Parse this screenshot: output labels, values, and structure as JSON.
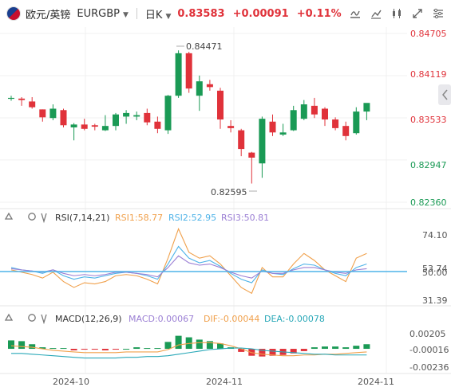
{
  "header": {
    "symbol_name": "欧元/英镑",
    "symbol_code": "EURGBP",
    "period": "日K",
    "last_price": "0.83583",
    "change": "+0.00091",
    "change_pct": "+0.11%",
    "tool_icons": [
      "indicator-icon",
      "compare-icon",
      "draw-icon",
      "fullscreen-icon",
      "settings-icon"
    ]
  },
  "main_chart": {
    "y_ticks": [
      "0.84705",
      "0.84119",
      "0.83533",
      "0.82947",
      "0.82360"
    ],
    "high_label": "0.84471",
    "low_label": "0.82595",
    "colors": {
      "up": "#1a9a55",
      "down": "#e0323a"
    }
  },
  "rsi": {
    "title": "RSI(7,14,21)",
    "rsi1": "RSI1:58.77",
    "rsi2": "RSI2:52.95",
    "rsi3": "RSI3:50.81",
    "y_ticks": [
      "74.10",
      "53.74",
      "50.00",
      "31.39"
    ],
    "colors": {
      "rsi1": "#f0a04b",
      "rsi2": "#4fb3e8",
      "rsi3": "#9b7fd4"
    }
  },
  "macd": {
    "title": "MACD(12,26,9)",
    "macd": "MACD:0.00067",
    "dif": "DIF:-0.00044",
    "dea": "DEA:-0.00078",
    "y_ticks": [
      "0.00205",
      "-0.00016",
      "-0.00236"
    ],
    "colors": {
      "macd": "#9b7fd4",
      "dif": "#f0a04b",
      "dea": "#29a8b8"
    }
  },
  "x_axis": {
    "labels": [
      "2024-10",
      "2024-11",
      "2024-11"
    ]
  },
  "chart_data": {
    "type": "candlestick",
    "title": "",
    "ylim": [
      0.8236,
      0.84705
    ],
    "candles": [
      {
        "o": 0.838,
        "h": 0.8384,
        "l": 0.8377,
        "c": 0.8381
      },
      {
        "o": 0.838,
        "h": 0.8382,
        "l": 0.837,
        "c": 0.8378
      },
      {
        "o": 0.8376,
        "h": 0.8382,
        "l": 0.8366,
        "c": 0.8368
      },
      {
        "o": 0.8365,
        "h": 0.8365,
        "l": 0.8348,
        "c": 0.8354
      },
      {
        "o": 0.8353,
        "h": 0.8372,
        "l": 0.835,
        "c": 0.8366
      },
      {
        "o": 0.8364,
        "h": 0.8366,
        "l": 0.834,
        "c": 0.8343
      },
      {
        "o": 0.834,
        "h": 0.8346,
        "l": 0.8322,
        "c": 0.8344
      },
      {
        "o": 0.8344,
        "h": 0.8352,
        "l": 0.8336,
        "c": 0.8338
      },
      {
        "o": 0.8343,
        "h": 0.8345,
        "l": 0.8336,
        "c": 0.8341
      },
      {
        "o": 0.8336,
        "h": 0.8357,
        "l": 0.8335,
        "c": 0.8342
      },
      {
        "o": 0.8342,
        "h": 0.836,
        "l": 0.8336,
        "c": 0.8358
      },
      {
        "o": 0.8355,
        "h": 0.8364,
        "l": 0.8345,
        "c": 0.836
      },
      {
        "o": 0.8355,
        "h": 0.8362,
        "l": 0.835,
        "c": 0.8357
      },
      {
        "o": 0.836,
        "h": 0.8366,
        "l": 0.8343,
        "c": 0.8347
      },
      {
        "o": 0.8348,
        "h": 0.8355,
        "l": 0.8332,
        "c": 0.8338
      },
      {
        "o": 0.8336,
        "h": 0.8385,
        "l": 0.8331,
        "c": 0.8384
      },
      {
        "o": 0.8384,
        "h": 0.8447,
        "l": 0.8381,
        "c": 0.8443
      },
      {
        "o": 0.8443,
        "h": 0.8445,
        "l": 0.8388,
        "c": 0.8394
      },
      {
        "o": 0.8384,
        "h": 0.8412,
        "l": 0.8363,
        "c": 0.8404
      },
      {
        "o": 0.84,
        "h": 0.8406,
        "l": 0.8391,
        "c": 0.8396
      },
      {
        "o": 0.8391,
        "h": 0.8395,
        "l": 0.8338,
        "c": 0.8351
      },
      {
        "o": 0.8342,
        "h": 0.835,
        "l": 0.8333,
        "c": 0.8339
      },
      {
        "o": 0.8336,
        "h": 0.8338,
        "l": 0.83,
        "c": 0.831
      },
      {
        "o": 0.8305,
        "h": 0.8306,
        "l": 0.8262,
        "c": 0.8298
      },
      {
        "o": 0.829,
        "h": 0.8355,
        "l": 0.827,
        "c": 0.8352
      },
      {
        "o": 0.8348,
        "h": 0.8358,
        "l": 0.8328,
        "c": 0.8333
      },
      {
        "o": 0.833,
        "h": 0.8345,
        "l": 0.8328,
        "c": 0.8333
      },
      {
        "o": 0.8336,
        "h": 0.837,
        "l": 0.8335,
        "c": 0.8364
      },
      {
        "o": 0.8352,
        "h": 0.8378,
        "l": 0.835,
        "c": 0.8372
      },
      {
        "o": 0.837,
        "h": 0.8381,
        "l": 0.8353,
        "c": 0.8358
      },
      {
        "o": 0.8366,
        "h": 0.8368,
        "l": 0.8342,
        "c": 0.8351
      },
      {
        "o": 0.8351,
        "h": 0.8354,
        "l": 0.8336,
        "c": 0.8339
      },
      {
        "o": 0.8342,
        "h": 0.8348,
        "l": 0.8322,
        "c": 0.8328
      },
      {
        "o": 0.8332,
        "h": 0.8368,
        "l": 0.833,
        "c": 0.8362
      },
      {
        "o": 0.8362,
        "h": 0.8373,
        "l": 0.835,
        "c": 0.8374
      }
    ],
    "rsi": {
      "ylim": [
        20,
        88
      ],
      "rsi1": [
        50,
        48,
        46,
        43,
        48,
        40,
        35,
        39,
        38,
        40,
        45,
        46,
        45,
        42,
        38,
        60,
        85,
        65,
        60,
        62,
        55,
        45,
        35,
        30,
        52,
        44,
        44,
        55,
        64,
        58,
        50,
        45,
        40,
        60,
        64
      ],
      "rsi2": [
        52,
        50,
        49,
        47,
        50,
        45,
        42,
        44,
        43,
        45,
        47,
        48,
        47,
        45,
        42,
        55,
        70,
        60,
        56,
        58,
        53,
        47,
        42,
        39,
        50,
        47,
        46,
        51,
        55,
        54,
        50,
        47,
        45,
        52,
        55
      ],
      "rsi3": [
        51,
        50,
        49,
        48,
        50,
        47,
        45,
        46,
        45,
        46,
        48,
        48,
        47,
        46,
        44,
        52,
        62,
        56,
        54,
        55,
        52,
        48,
        45,
        43,
        49,
        47,
        47,
        50,
        52,
        52,
        50,
        48,
        47,
        50,
        51
      ]
    },
    "macd": {
      "ylim": [
        -0.0029,
        0.0027
      ],
      "hist": [
        0.0011,
        0.001,
        0.0006,
        0.0002,
        0.0001,
        0.0001,
        -0.0002,
        -0.0001,
        -0.0001,
        -0.0002,
        -0.0001,
        0.0,
        0.0002,
        0.0001,
        0.0001,
        0.0009,
        0.0017,
        0.0015,
        0.0012,
        0.001,
        0.0007,
        0.0002,
        -0.0004,
        -0.0009,
        -0.001,
        -0.0009,
        -0.0008,
        -0.0006,
        -0.0003,
        0.0002,
        0.0003,
        0.0003,
        0.0002,
        0.0004,
        0.0006
      ],
      "dif": [
        0.0004,
        0.0003,
        0.0002,
        0.0,
        -0.0002,
        -0.0003,
        -0.0004,
        -0.0005,
        -0.0005,
        -0.0005,
        -0.0005,
        -0.0004,
        -0.0004,
        -0.0004,
        -0.0004,
        -0.0001,
        0.0005,
        0.0007,
        0.0008,
        0.0008,
        0.0007,
        0.0004,
        0.0,
        -0.0005,
        -0.0007,
        -0.0008,
        -0.0009,
        -0.0009,
        -0.0008,
        -0.0008,
        -0.0007,
        -0.0007,
        -0.0006,
        -0.0005,
        -0.0004
      ],
      "dea": [
        -0.0006,
        -0.0006,
        -0.0007,
        -0.0008,
        -0.0009,
        -0.001,
        -0.0011,
        -0.0012,
        -0.0012,
        -0.0012,
        -0.0012,
        -0.0011,
        -0.0011,
        -0.001,
        -0.001,
        -0.0009,
        -0.0007,
        -0.0005,
        -0.0003,
        -0.0001,
        0.0,
        0.0001,
        0.0001,
        0.0,
        -0.0002,
        -0.0003,
        -0.0004,
        -0.0005,
        -0.0006,
        -0.0007,
        -0.0007,
        -0.0008,
        -0.0008,
        -0.0008,
        -0.0008
      ]
    }
  }
}
